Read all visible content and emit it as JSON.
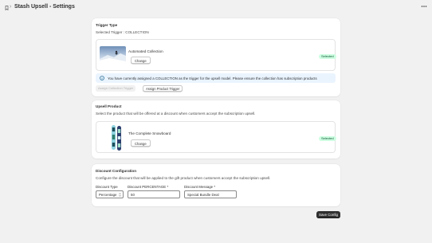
{
  "header": {
    "separator": "›",
    "title": "Stash Upsell - Settings",
    "more_icon": "more-horizontal-icon"
  },
  "trigger": {
    "title": "Trigger Type",
    "selected_text": "Selected Trigger : COLLECTION",
    "item_name": "Automated Collection",
    "change_label": "Change",
    "badge": "Selected",
    "banner_text": "You have currently assigned a COLLECTION as the trigger for the upsell model. Please ensure the collection has subscription products",
    "collection_btn": "Assign Collection Trigger",
    "product_btn": "Assign Product Trigger"
  },
  "upsell": {
    "title": "Upsell Product",
    "description": "Select the product that will be offered at a discount when customers accept the subscription upsell.",
    "item_name": "The Complete Snowboard",
    "change_label": "Change",
    "badge": "Selected"
  },
  "discount": {
    "title": "Discount Configuration",
    "description": "Configure the discount that will be applied to the gift product when customers accept the subscription upsell.",
    "type_label": "Discount Type",
    "type_value": "Percentage",
    "amount_label": "Discount PERCENTAGE *",
    "amount_value": "50",
    "message_label": "Discount Message *",
    "message_value": "Special Bundle Deal"
  },
  "save_label": "Save Config",
  "colors": {
    "background": "#f1f1f1",
    "badge_bg": "#cdfee1",
    "badge_text": "#0c5132",
    "banner_bg": "#eaf4ff",
    "primary_button": "#303030"
  }
}
